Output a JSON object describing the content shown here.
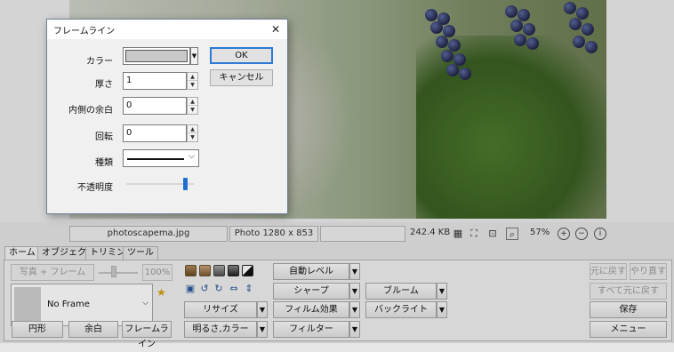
{
  "status_bar": {
    "filename": "photoscapema.jpg",
    "dimensions": "Photo 1280 x 853",
    "filesize": "242.4 KB",
    "zoom": "57%"
  },
  "ribbon": {
    "tabs": [
      "ホーム",
      "オブジェクト",
      "トリミング",
      "ツール"
    ],
    "photo_frame_label": "写真 + フレーム",
    "zoom_percent": "100%",
    "frame_name": "No Frame",
    "circle_label": "円形",
    "margin_label": "余白",
    "frameline_label": "フレームライン",
    "auto_level": "自動レベル",
    "sharpen": "シャープ",
    "bloom": "ブルーム",
    "resize": "リサイズ",
    "film_effect": "フィルム効果",
    "backlight": "バックライト",
    "brightness_color": "明るさ,カラー",
    "filter": "フィルター",
    "undo": "元に戻す",
    "redo": "やり直す",
    "undo_all": "すべて元に戻す",
    "save": "保存",
    "menu": "メニュー"
  },
  "dialog": {
    "title": "フレームライン",
    "color_label": "カラー",
    "color_value": "#c8c8c8",
    "thickness_label": "厚さ",
    "thickness_value": "1",
    "inner_margin_label": "内側の余白",
    "inner_margin_value": "0",
    "rotation_label": "回転",
    "rotation_value": "0",
    "type_label": "種類",
    "opacity_label": "不透明度",
    "opacity_level": 0.9,
    "ok_label": "OK",
    "cancel_label": "キャンセル"
  }
}
